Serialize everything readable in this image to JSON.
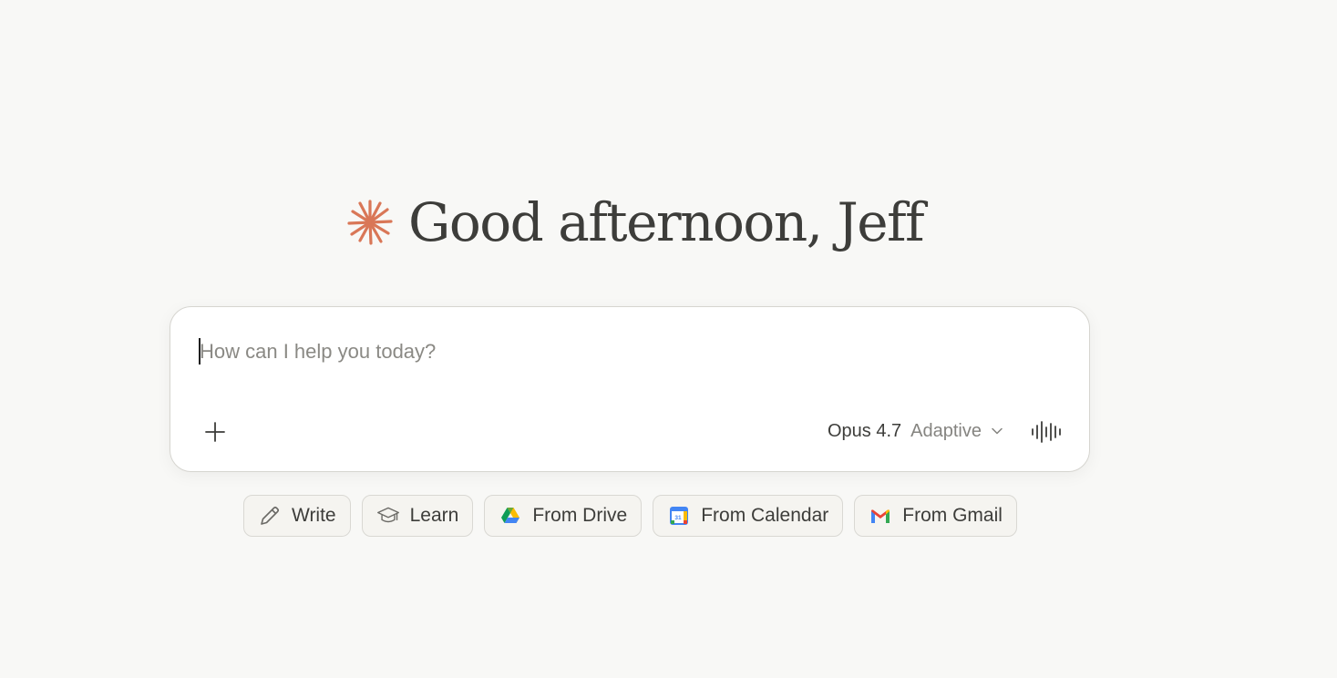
{
  "greeting": {
    "text": "Good afternoon, Jeff",
    "logo_icon": "starburst-icon",
    "logo_color": "#d97757"
  },
  "composer": {
    "placeholder": "How can I help you today?",
    "value": "",
    "add_icon": "plus-icon",
    "model_name": "Opus 4.7",
    "model_mode": "Adaptive",
    "dropdown_icon": "chevron-down-icon",
    "voice_icon": "voice-waveform-icon"
  },
  "chips": [
    {
      "label": "Write",
      "icon": "pencil-icon"
    },
    {
      "label": "Learn",
      "icon": "graduation-cap-icon"
    },
    {
      "label": "From Drive",
      "icon": "google-drive-icon"
    },
    {
      "label": "From Calendar",
      "icon": "google-calendar-icon"
    },
    {
      "label": "From Gmail",
      "icon": "gmail-icon"
    }
  ],
  "colors": {
    "background": "#f8f8f6",
    "accent": "#d97757",
    "text": "#3d3d3a",
    "muted": "#858480"
  }
}
